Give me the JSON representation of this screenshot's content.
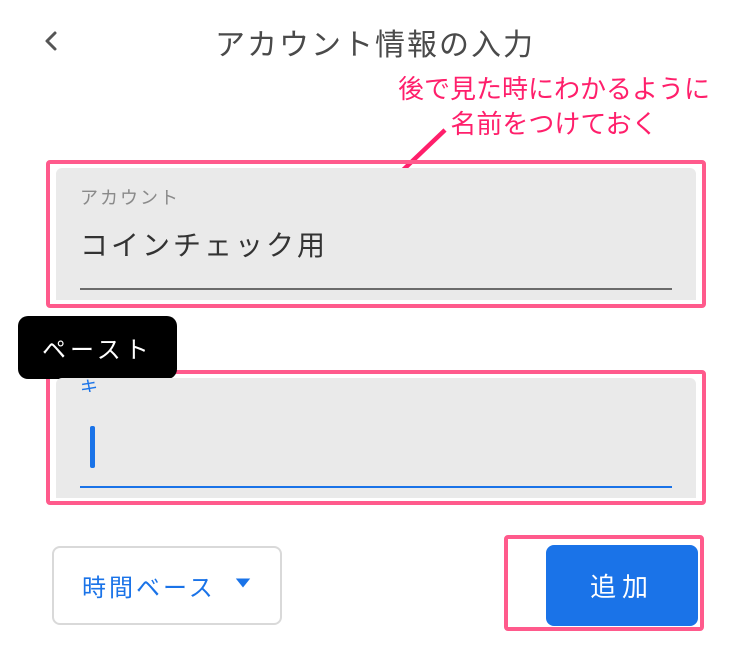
{
  "header": {
    "title": "アカウント情報の入力"
  },
  "annotation": {
    "line1": "後で見た時にわかるように",
    "line2": "名前をつけておく"
  },
  "fields": {
    "account": {
      "label": "アカウント",
      "value": "コインチェック用"
    },
    "key": {
      "label_partial": "キ",
      "value": ""
    }
  },
  "tooltip": {
    "paste": "ペースト"
  },
  "bottom": {
    "type_label": "時間ベース",
    "add_label": "追加"
  },
  "colors": {
    "accent": "#1a73e8",
    "highlight": "#ff5a8c",
    "annotation_text": "#ff1f6b"
  }
}
